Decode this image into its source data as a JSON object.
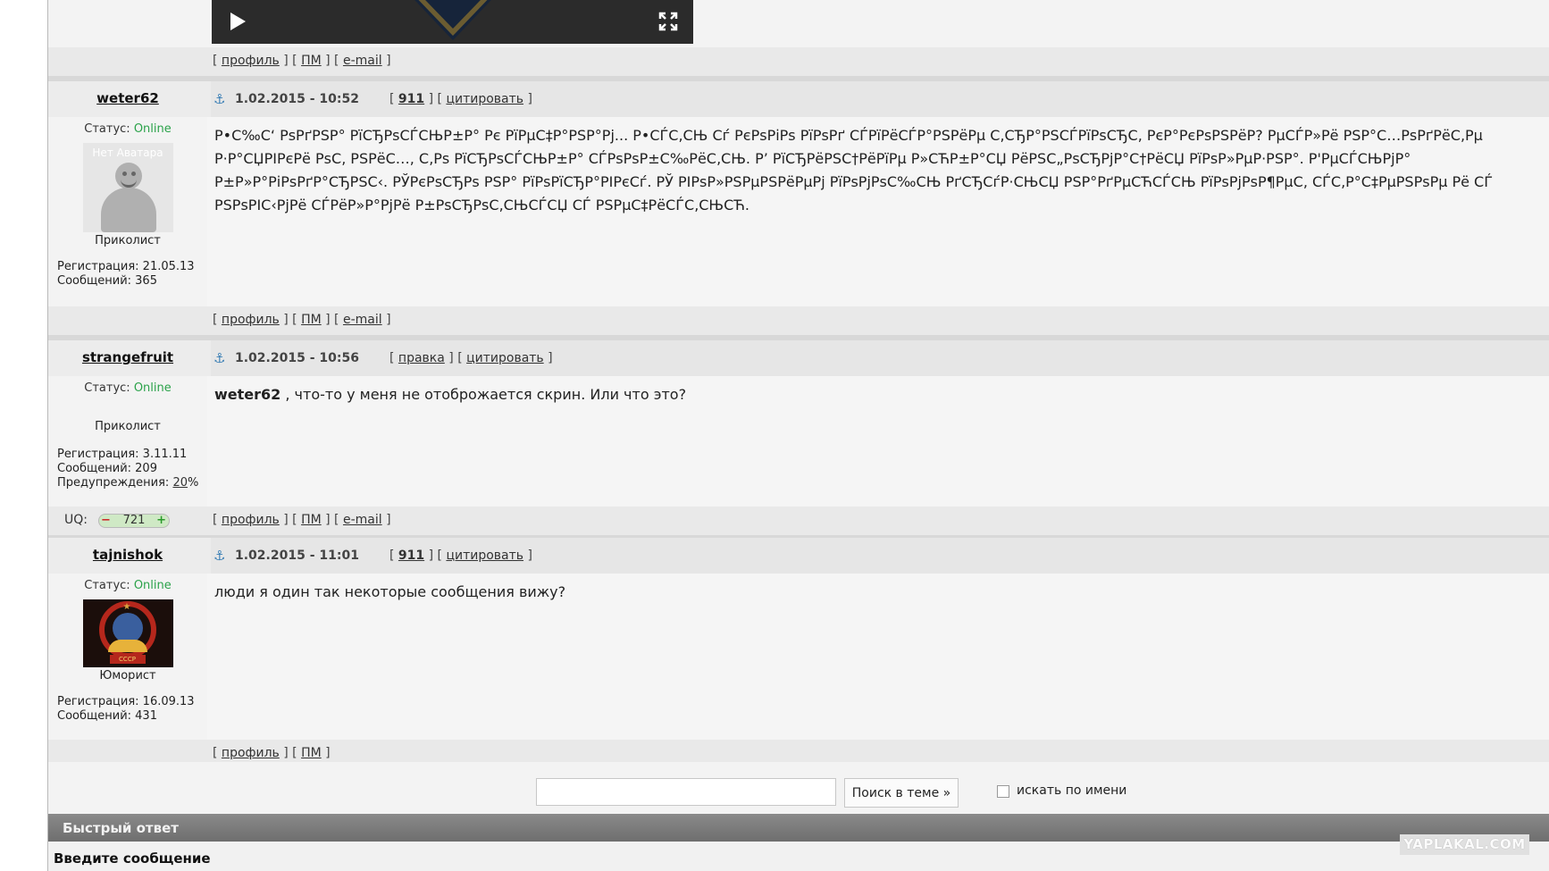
{
  "footer_links": {
    "profile": "профиль",
    "pm": "ПМ",
    "email": "e-mail"
  },
  "posts": [
    {
      "username": "weter62",
      "date": "1.02.2015 - 10:52",
      "action1": "911",
      "action2": "цитировать",
      "status_label": "Статус:",
      "status_value": "Online",
      "avatar_caption": "Нет Аватара",
      "rank": "Приколист",
      "reg": "Регистрация: 21.05.13",
      "count": "Сообщений: 365",
      "text": "Р•С‰С‘ РѕРґРЅР° РїСЂРѕСЃСЊР±Р° Рє РїРµС‡Р°РЅР°Рј... Р•СЃС‚СЊ Сѓ РєРѕРіРѕ РїРѕРґ СЃРїРёСЃР°РЅРёРµ С‚СЂР°РЅСЃРїРѕСЂС‚ РєР°РєРѕРЅРёР? РµСЃР»Рё РЅР°С…РѕРґРёС‚Рµ Р·Р°СЏРІРєРё РѕС‚ РЅРёС…, С‚Рѕ РїСЂРѕСЃСЊР±Р° СЃРѕРѕР±С‰РёС‚СЊ. Р’ РїСЂРёРЅС†РёРїРµ Р»СЋР±Р°СЏ РёРЅС„РѕСЂРјР°С†РёСЏ РїРѕР»РµР·РЅР°. Р'РµСЃСЊРјР° Р±Р»Р°РіРѕРґР°СЂРЅС‹. РЎРєРѕСЂРѕ РЅР° РїРѕРїСЂР°РІРєСѓ. РЎ РІРѕР»РЅРµРЅРёРµРј РїРѕРјРѕС‰СЊ РґСЂСѓР·СЊСЏ РЅР°РґРµСЋСЃСЊ РїРѕРјРѕР¶РµС‚ СЃС‚Р°С‡РµРЅРѕРµ Рё СЃ РЅРѕРІС‹РјРё СЃРёР»Р°РјРё Р±РѕСЂРѕС‚СЊСЃСЏ СЃ РЅРµС‡РёСЃС‚СЊСЋ."
    },
    {
      "username": "strangefruit",
      "date": "1.02.2015 - 10:56",
      "action1": "правка",
      "action2": "цитировать",
      "status_label": "Статус:",
      "status_value": "Online",
      "rank": "Приколист",
      "reg": "Регистрация: 3.11.11",
      "count": "Сообщений: 209",
      "warn_label": "Предупреждения:",
      "warn_value": "20",
      "warn_suffix": "%",
      "uq_label": "UQ:",
      "uq_value": "721",
      "text_bold": "weter62",
      "text": " , что-то у меня не отоброжается скрин. Или что это?"
    },
    {
      "username": "tajnishok",
      "date": "1.02.2015 - 11:01",
      "action1": "911",
      "action2": "цитировать",
      "status_label": "Статус:",
      "status_value": "Online",
      "avatar_text": "СССР",
      "rank": "Юморист",
      "reg": "Регистрация: 16.09.13",
      "count": "Сообщений: 431",
      "text": "люди я один так некоторые сообщения вижу?"
    }
  ],
  "search": {
    "button": "Поиск в теме »",
    "checkbox_label": "искать по имени"
  },
  "quick_reply": "Быстрый ответ",
  "enter_message": "Введите сообщение",
  "watermark": "YAPLAKAL.COM",
  "colors": {
    "online": "#2ba24a",
    "highlight": "#cc0000",
    "bar": "#7a7a7a"
  }
}
